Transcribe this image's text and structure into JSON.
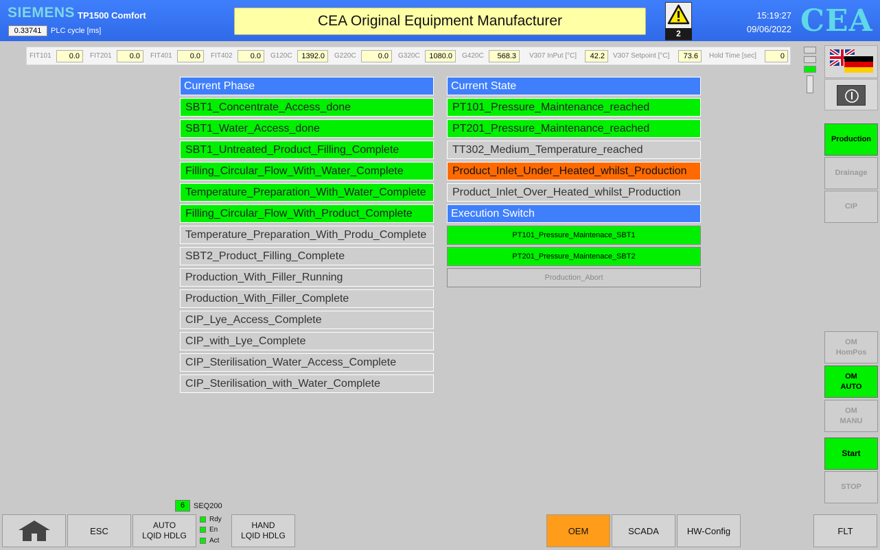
{
  "header": {
    "brand": "SIEMENS",
    "model": "TP1500 Comfort",
    "plc_cycle_value": "0.33741",
    "plc_cycle_label": "PLC cycle [ms]",
    "title": "CEA Original Equipment Manufacturer",
    "alarm_count": "2",
    "time": "15:19:27",
    "date": "09/06/2022",
    "logo": "CEA"
  },
  "sensors": [
    {
      "label": "FIT101",
      "value": "0.0"
    },
    {
      "label": "FIT201",
      "value": "0.0"
    },
    {
      "label": "FIT401",
      "value": "0.0"
    },
    {
      "label": "FIT402",
      "value": "0.0"
    },
    {
      "label": "G120C",
      "value": "1392.0"
    },
    {
      "label": "G220C",
      "value": "0.0"
    },
    {
      "label": "G320C",
      "value": "1080.0"
    },
    {
      "label": "G420C",
      "value": "568.3"
    },
    {
      "label": "V307 InPut [°C]",
      "value": "42.2"
    },
    {
      "label": "V307 Setpoint [°C]",
      "value": "73.6"
    },
    {
      "label": "Hold Time [sec]",
      "value": "0"
    }
  ],
  "phase": {
    "header": "Current Phase",
    "items": [
      {
        "label": "SBT1_Concentrate_Access_done",
        "state": "green"
      },
      {
        "label": "SBT1_Water_Access_done",
        "state": "green"
      },
      {
        "label": "SBT1_Untreated_Product_Filling_Complete",
        "state": "green"
      },
      {
        "label": "Filling_Circular_Flow_With_Water_Complete",
        "state": "green"
      },
      {
        "label": "Temperature_Preparation_With_Water_Complete",
        "state": "green"
      },
      {
        "label": "Filling_Circular_Flow_With_Product_Complete",
        "state": "green"
      },
      {
        "label": "Temperature_Preparation_With_Produ_Complete",
        "state": "gray"
      },
      {
        "label": "SBT2_Product_Filling_Complete",
        "state": "gray"
      },
      {
        "label": "Production_With_Filler_Running",
        "state": "gray"
      },
      {
        "label": "Production_With_Filler_Complete",
        "state": "gray"
      },
      {
        "label": "CIP_Lye_Access_Complete",
        "state": "gray"
      },
      {
        "label": "CIP_with_Lye_Complete",
        "state": "gray"
      },
      {
        "label": "CIP_Sterilisation_Water_Access_Complete",
        "state": "gray"
      },
      {
        "label": "CIP_Sterilisation_with_Water_Complete",
        "state": "gray"
      }
    ]
  },
  "state": {
    "header": "Current State",
    "items": [
      {
        "label": "PT101_Pressure_Maintenance_reached",
        "state": "green"
      },
      {
        "label": "PT201_Pressure_Maintenance_reached",
        "state": "green"
      },
      {
        "label": "TT302_Medium_Temperature_reached",
        "state": "gray"
      },
      {
        "label": "Product_Inlet_Under_Heated_whilst_Production",
        "state": "orange"
      },
      {
        "label": "Product_Inlet_Over_Heated_whilst_Production",
        "state": "gray"
      }
    ]
  },
  "switch": {
    "header": "Execution Switch",
    "buttons": [
      {
        "label": "PT101_Pressure_Maintenace_SBT1",
        "state": "green"
      },
      {
        "label": "PT201_Pressure_Maintenace_SBT2",
        "state": "green"
      },
      {
        "label": "Production_Abort",
        "state": "gray"
      }
    ]
  },
  "side": {
    "production": "Production",
    "drainage": "Drainage",
    "cip": "CIP",
    "om_hompos_1": "OM",
    "om_hompos_2": "HomPos",
    "om_auto_1": "OM",
    "om_auto_2": "AUTO",
    "om_manu_1": "OM",
    "om_manu_2": "MANU",
    "start": "Start",
    "stop": "STOP"
  },
  "bottom": {
    "seq_num": "6",
    "seq_label": "SEQ200",
    "esc": "ESC",
    "auto_1": "AUTO",
    "auto_2": "LQID HDLG",
    "rdy": "Rdy",
    "en": "En",
    "act": "Act",
    "hand_1": "HAND",
    "hand_2": "LQID HDLG",
    "oem": "OEM",
    "scada": "SCADA",
    "hwconfig": "HW-Config",
    "flt": "FLT"
  },
  "colors": {
    "header_blue": "#3f7ffc",
    "active_green": "#00f000",
    "alarm_orange": "#ff6a00",
    "oem_orange": "#ff9c1a"
  }
}
